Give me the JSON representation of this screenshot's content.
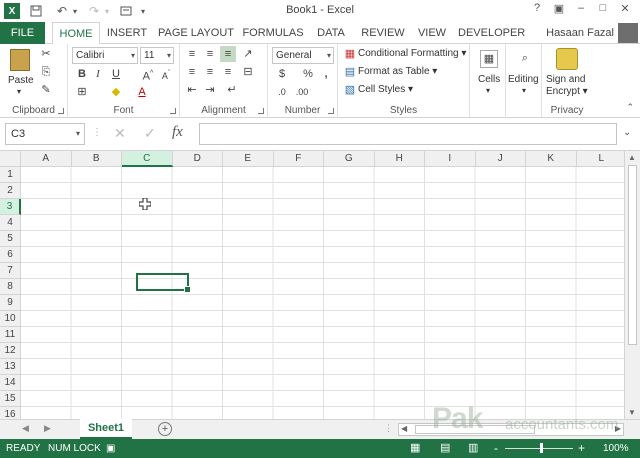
{
  "app": {
    "title": "Book1 - Excel",
    "help": "?",
    "user": "Hasaan Fazal"
  },
  "colors": {
    "accent": "#217346",
    "status_bg": "#217346"
  },
  "tabs": [
    "FILE",
    "HOME",
    "INSERT",
    "PAGE LAYOUT",
    "FORMULAS",
    "DATA",
    "REVIEW",
    "VIEW",
    "DEVELOPER"
  ],
  "ribbon": {
    "clipboard": {
      "paste": "Paste",
      "label": "Clipboard"
    },
    "font": {
      "name": "Calibri",
      "size": "11",
      "label": "Font"
    },
    "alignment": {
      "label": "Alignment"
    },
    "number": {
      "format": "General",
      "label": "Number",
      "currency": "$",
      "percent": "%",
      "comma": ","
    },
    "styles": {
      "conditional": "Conditional Formatting",
      "format_table": "Format as Table",
      "cell_styles": "Cell Styles",
      "label": "Styles"
    },
    "cells": {
      "label": "Cells"
    },
    "editing": {
      "label": "Editing"
    },
    "privacy": {
      "sign": "Sign and",
      "encrypt": "Encrypt",
      "label": "Privacy"
    }
  },
  "formula_bar": {
    "name_box": "C3",
    "fx": "fx",
    "value": ""
  },
  "columns": [
    "A",
    "B",
    "C",
    "D",
    "E",
    "F",
    "G",
    "H",
    "I",
    "J",
    "K",
    "L"
  ],
  "rows": [
    "1",
    "2",
    "3",
    "4",
    "5",
    "6",
    "7",
    "8",
    "9",
    "10",
    "11",
    "12",
    "13",
    "14",
    "15",
    "16"
  ],
  "selected_column": "C",
  "selected_row": "3",
  "sheets": [
    "Sheet1"
  ],
  "status": {
    "ready": "READY",
    "numlock": "NUM LOCK",
    "zoom": "100%",
    "minus": "-",
    "plus": "+"
  },
  "watermark": {
    "main": "Pak",
    "sub": "accountants.com"
  }
}
